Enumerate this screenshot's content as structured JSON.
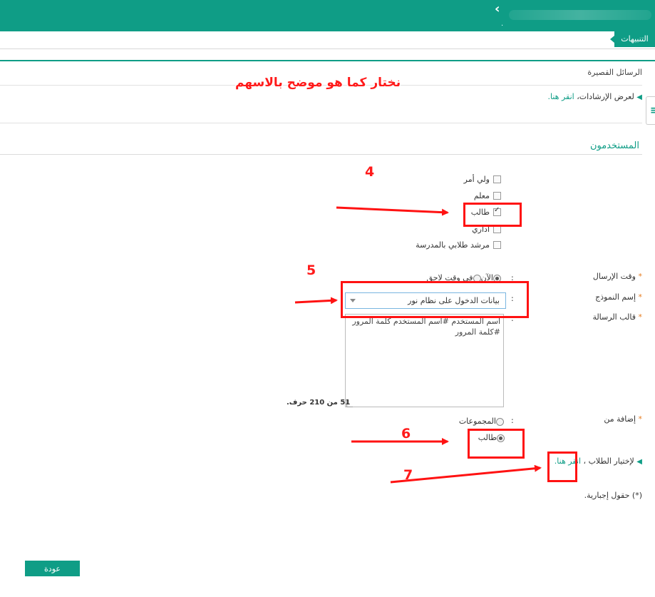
{
  "header": {
    "alerts_tab": "التنبيهات"
  },
  "page": {
    "title": "الرسائل القصيرة",
    "guide_text": "لعرض الإرشادات،",
    "guide_link": "انقر هنا.",
    "annotation_title": "نختار كما هو موضح بالاسهم"
  },
  "section": {
    "title": "المستخدمون",
    "user_types": [
      {
        "label": "ولي أمر",
        "checked": false
      },
      {
        "label": "معلم",
        "checked": false
      },
      {
        "label": "طالب",
        "checked": true
      },
      {
        "label": "اداري",
        "checked": false
      },
      {
        "label": "مرشد طلابي بالمدرسة",
        "checked": false
      }
    ]
  },
  "form": {
    "send_time_label": "وقت الإرسال",
    "send_time_options": [
      "الآن",
      "في وقت لاحق"
    ],
    "template_name_label": "إسم النموذج",
    "template_selected": "بيانات الدخول على نظام نور",
    "message_template_label": "قالب الرسالة",
    "message_body": "اسم المستخدم #اسم المستخدم كلمة المرور #كلمة المرور",
    "char_count": "51 من 210 حرف.",
    "add_from_label": "إضافة  من",
    "add_from_options": [
      "المجموعات",
      "طالب"
    ],
    "choose_students_text": "لإختيار الطلاب ،",
    "choose_students_link": "انقر هنا.",
    "required_note": "(*) حقول إجبارية.",
    "required_marker": "*",
    "colon": ":"
  },
  "footer": {
    "back_label": "عودة"
  },
  "annotations": {
    "n4": "4",
    "n5": "5",
    "n6": "6",
    "n7": "7"
  },
  "colors": {
    "brand": "#0f9d86",
    "annotation": "#ff1212"
  }
}
